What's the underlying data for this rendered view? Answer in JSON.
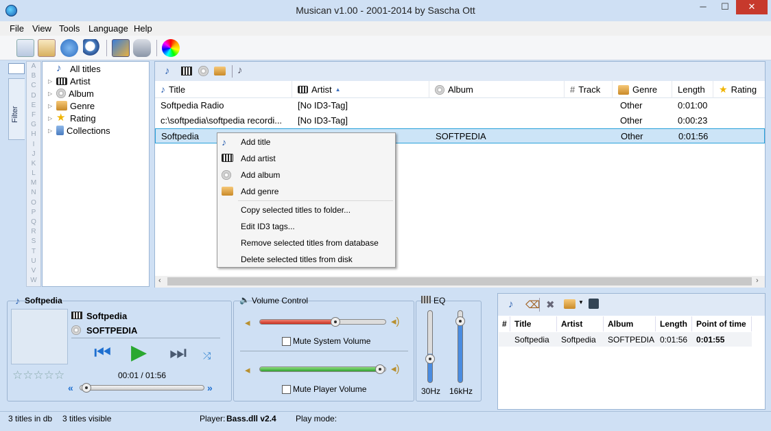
{
  "window": {
    "title": "Musican v1.00 - 2001-2014 by Sascha Ott",
    "minimize": "─",
    "maximize": "☐",
    "close": "✕"
  },
  "menu": {
    "file": "File",
    "view": "View",
    "tools": "Tools",
    "language": "Language",
    "help": "Help"
  },
  "sidebar": {
    "filter_tab": "Filter",
    "alphabet": [
      "A",
      "B",
      "C",
      "D",
      "E",
      "F",
      "G",
      "H",
      "I",
      "J",
      "K",
      "L",
      "M",
      "N",
      "O",
      "P",
      "Q",
      "R",
      "S",
      "T",
      "U",
      "V",
      "W"
    ],
    "tree": [
      {
        "label": "All titles",
        "icon": "note-icon"
      },
      {
        "label": "Artist",
        "icon": "piano-icon"
      },
      {
        "label": "Album",
        "icon": "cd-icon"
      },
      {
        "label": "Genre",
        "icon": "folder-genre-icon"
      },
      {
        "label": "Rating",
        "icon": "star-icon"
      },
      {
        "label": "Collections",
        "icon": "collections-icon"
      }
    ]
  },
  "columns": {
    "title": "Title",
    "artist": "Artist",
    "album": "Album",
    "track": "Track",
    "genre": "Genre",
    "length": "Length",
    "rating": "Rating"
  },
  "rows": [
    {
      "title": "Softpedia Radio",
      "artist": "[No ID3-Tag]",
      "album": "",
      "genre": "Other",
      "length": "0:01:00"
    },
    {
      "title": "c:\\softpedia\\softpedia recordi...",
      "artist": "[No ID3-Tag]",
      "album": "",
      "genre": "Other",
      "length": "0:00:23"
    },
    {
      "title": "Softpedia",
      "artist": "",
      "album": "SOFTPEDIA",
      "genre": "Other",
      "length": "0:01:56"
    }
  ],
  "context_menu": {
    "add_title": "Add title",
    "add_artist": "Add artist",
    "add_album": "Add album",
    "add_genre": "Add genre",
    "copy": "Copy selected titles to folder...",
    "edit": "Edit ID3 tags...",
    "remove": "Remove selected titles from database",
    "delete": "Delete selected titles from disk"
  },
  "player": {
    "header": "Softpedia",
    "title": "Softpedia",
    "album": "SOFTPEDIA",
    "time": "00:01  /  01:56",
    "rating_stars": "☆☆☆☆☆",
    "progress": 0.02
  },
  "volume": {
    "header": "Volume Control",
    "mute_system": "Mute System Volume",
    "mute_player": "Mute Player Volume",
    "system_level": 0.6,
    "player_level": 0.95
  },
  "eq": {
    "header": "EQ",
    "low": "30Hz",
    "high": "16kHz"
  },
  "playlist": {
    "columns": {
      "num": "#",
      "title": "Title",
      "artist": "Artist",
      "album": "Album",
      "length": "Length",
      "point": "Point of time"
    },
    "rows": [
      {
        "title": "Softpedia",
        "artist": "Softpedia",
        "album": "SOFTPEDIA",
        "length": "0:01:56",
        "point": "0:01:55"
      }
    ]
  },
  "status": {
    "db": "3 titles in db",
    "visible": "3 titles visible",
    "player_label": "Player:",
    "player_value": "Bass.dll v2.4",
    "play_mode": "Play mode:"
  }
}
